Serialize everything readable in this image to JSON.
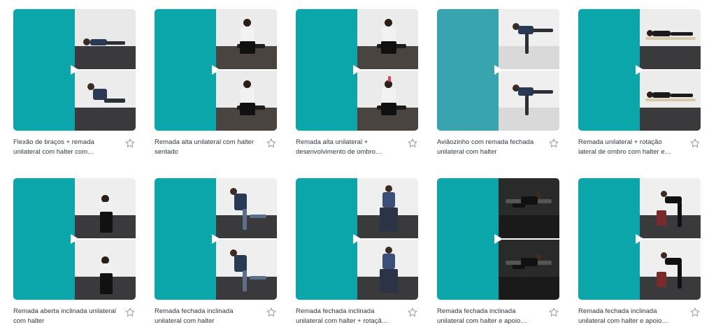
{
  "colors": {
    "accent": "#0aa6a9",
    "accent_alt": "#37a4b0",
    "text": "#2f3a44",
    "star_outline": "#8a939b"
  },
  "cards": [
    {
      "title": "Flexão de braços + remada unilateral com halter com…",
      "icon": "play-icon",
      "star_icon": "star-outline-icon"
    },
    {
      "title": "Remada alta unilateral com halter sentado",
      "icon": "play-icon",
      "star_icon": "star-outline-icon"
    },
    {
      "title": "Remada alta unilateral + desenvolvimento de ombro…",
      "icon": "play-icon",
      "star_icon": "star-outline-icon"
    },
    {
      "title": "Aviãozinho com remada fechada unilateral com halter",
      "icon": "play-icon",
      "star_icon": "star-outline-icon"
    },
    {
      "title": "Remada unilateral + rotação lateral de ombro com halter e…",
      "icon": "play-icon",
      "star_icon": "star-outline-icon"
    },
    {
      "title": "Remada aberta inclinada unilateral com halter",
      "icon": "play-icon",
      "star_icon": "star-outline-icon"
    },
    {
      "title": "Remada fechada inclinada unilateral com halter",
      "icon": "play-icon",
      "star_icon": "star-outline-icon"
    },
    {
      "title": "Remada fechada inclinada unilateral com halter + rotaçã…",
      "icon": "play-icon",
      "star_icon": "star-outline-icon"
    },
    {
      "title": "Remada fechada inclinada unilateral com halter e apoio…",
      "icon": "play-icon",
      "star_icon": "star-outline-icon"
    },
    {
      "title": "Remada fechada inclinada unilateral com halter e apoio…",
      "icon": "play-icon",
      "star_icon": "star-outline-icon"
    }
  ]
}
